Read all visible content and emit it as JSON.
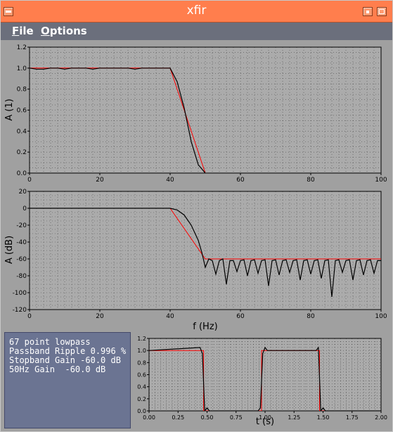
{
  "window": {
    "title": "xfir"
  },
  "menu": [
    {
      "label": "File",
      "accel": "F",
      "rest": "ile"
    },
    {
      "label": "Options",
      "accel": "O",
      "rest": "ptions"
    }
  ],
  "info": {
    "lines": [
      "67 point lowpass",
      "Passband Ripple 0.996 %",
      "Stopband Gain -60.0 dB",
      "50Hz Gain  -60.0 dB"
    ]
  },
  "colors": {
    "titlebar": "#ff7e4d",
    "menubar": "#6b6f7c",
    "info_bg": "#6b7492",
    "plot_bg": "#ababab",
    "actual": "#000000",
    "ideal": "#ff0000"
  },
  "chart_data": [
    {
      "type": "line",
      "title": "",
      "xlabel": "",
      "ylabel": "A (1)",
      "xlim": [
        0,
        100
      ],
      "ylim": [
        0,
        1.2
      ],
      "xticks": [
        0,
        20,
        40,
        60,
        80,
        100
      ],
      "yticks": [
        0.0,
        0.2,
        0.4,
        0.6,
        0.8,
        1.0,
        1.2
      ],
      "ytick_labels": [
        "0.0",
        "0.2",
        "0.4",
        "0.6",
        "0.8",
        "1.0",
        "1.2"
      ],
      "grid": true,
      "series": [
        {
          "color": "#000000",
          "x": [
            0,
            2,
            4,
            6,
            8,
            10,
            12,
            14,
            16,
            18,
            20,
            22,
            24,
            26,
            28,
            30,
            32,
            34,
            36,
            38,
            40,
            42,
            44,
            46,
            48,
            50
          ],
          "y": [
            1.0,
            0.99,
            0.99,
            1.0,
            1.0,
            0.99,
            1.0,
            1.0,
            1.0,
            0.99,
            1.0,
            1.0,
            1.0,
            1.0,
            1.0,
            0.99,
            1.0,
            1.0,
            1.0,
            1.0,
            1.0,
            0.87,
            0.62,
            0.3,
            0.08,
            0.0
          ]
        },
        {
          "color": "#ff0000",
          "x": [
            0,
            40,
            50
          ],
          "y": [
            1.0,
            1.0,
            0.0
          ]
        }
      ]
    },
    {
      "type": "line",
      "title": "",
      "xlabel": "f (Hz)",
      "ylabel": "A (dB)",
      "xlim": [
        0,
        100
      ],
      "ylim": [
        -120,
        20
      ],
      "xticks": [
        0,
        20,
        40,
        60,
        80,
        100
      ],
      "yticks": [
        20,
        0,
        -20,
        -40,
        -60,
        -80,
        -100,
        -120
      ],
      "ytick_labels": [
        "20",
        "0",
        "-20",
        "-40",
        "-60",
        "-80",
        "-100",
        "-120"
      ],
      "grid": true,
      "series": [
        {
          "color": "#000000",
          "x": [
            0,
            40,
            42,
            44,
            46,
            48,
            49,
            50,
            51,
            52,
            53,
            54,
            55,
            56,
            57,
            58,
            59,
            60,
            61,
            62,
            63,
            64,
            65,
            66,
            67,
            68,
            69,
            70,
            71,
            72,
            73,
            74,
            75,
            76,
            77,
            78,
            79,
            80,
            81,
            82,
            83,
            84,
            85,
            86,
            87,
            88,
            89,
            90,
            91,
            92,
            93,
            94,
            95,
            96,
            97,
            98,
            99,
            100
          ],
          "y": [
            0,
            0,
            -2,
            -8,
            -20,
            -38,
            -52,
            -70,
            -60,
            -62,
            -78,
            -62,
            -60,
            -90,
            -62,
            -62,
            -75,
            -62,
            -61,
            -80,
            -62,
            -61,
            -77,
            -62,
            -61,
            -92,
            -62,
            -61,
            -79,
            -62,
            -61,
            -76,
            -62,
            -61,
            -85,
            -62,
            -61,
            -78,
            -62,
            -61,
            -83,
            -62,
            -61,
            -105,
            -62,
            -61,
            -76,
            -62,
            -61,
            -85,
            -62,
            -61,
            -79,
            -62,
            -61,
            -77,
            -62,
            -62
          ]
        },
        {
          "color": "#ff0000",
          "x": [
            0,
            40,
            50,
            100
          ],
          "y": [
            0,
            0,
            -60,
            -60
          ]
        }
      ]
    },
    {
      "type": "line",
      "title": "",
      "xlabel": "t (s)",
      "ylabel": "",
      "xlim": [
        0,
        2
      ],
      "ylim": [
        0,
        1.2
      ],
      "xticks": [
        0.0,
        0.25,
        0.5,
        0.75,
        1.0,
        1.25,
        1.5,
        1.75,
        2.0
      ],
      "xtick_labels": [
        "0.00",
        "0.25",
        "0.50",
        "0.75",
        "1.00",
        "1.25",
        "1.50",
        "1.75",
        "2.00"
      ],
      "yticks": [
        0.0,
        0.2,
        0.4,
        0.6,
        0.8,
        1.0,
        1.2
      ],
      "ytick_labels": [
        "0.0",
        "0.2",
        "0.4",
        "0.6",
        "0.8",
        "1.0",
        "1.2"
      ],
      "grid": true,
      "series": [
        {
          "color": "#000000",
          "x": [
            0,
            0.44,
            0.46,
            0.48,
            0.5,
            0.52,
            0.94,
            0.96,
            0.98,
            1.0,
            1.02,
            1.44,
            1.46,
            1.48,
            1.5,
            1.52,
            2.0
          ],
          "y": [
            1.0,
            1.05,
            0.95,
            0.0,
            0.05,
            0.0,
            0.0,
            0.05,
            0.95,
            1.05,
            1.0,
            1.0,
            1.05,
            0.0,
            0.05,
            0.0,
            0.0
          ]
        },
        {
          "color": "#ff0000",
          "x": [
            0,
            0.47,
            0.47,
            0.97,
            0.97,
            1.47,
            1.47,
            2.0
          ],
          "y": [
            1.0,
            1.0,
            0.0,
            0.0,
            1.0,
            1.0,
            0.0,
            0.0
          ]
        }
      ]
    }
  ]
}
